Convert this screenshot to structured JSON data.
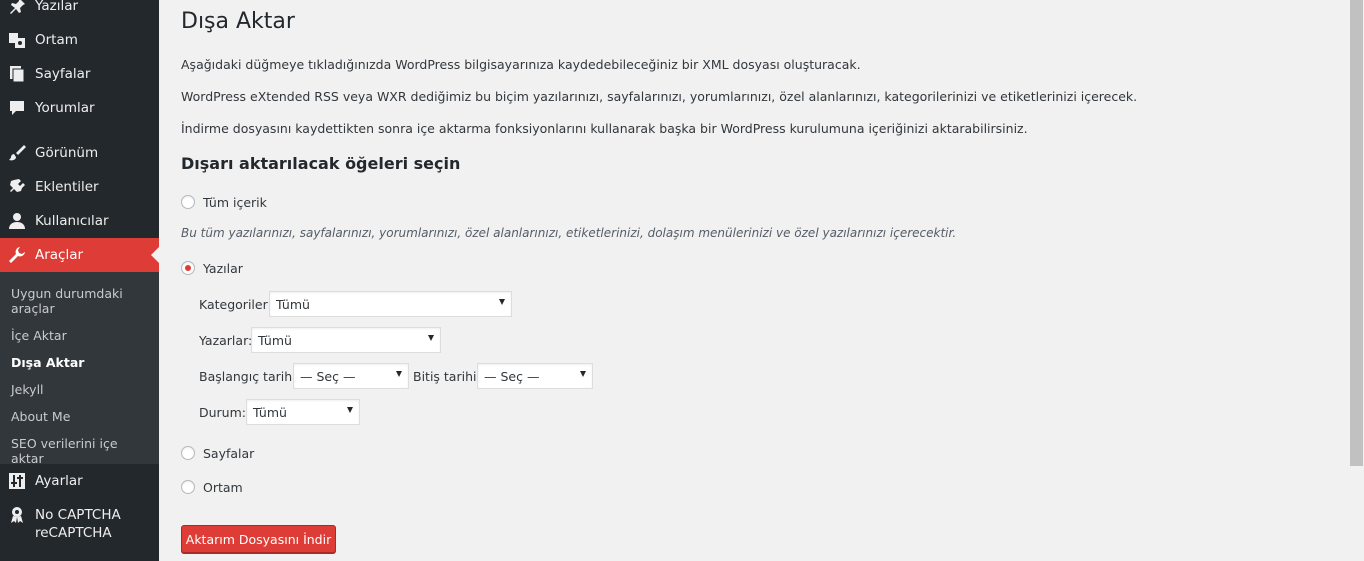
{
  "sidebar": {
    "items": [
      {
        "label": "Yazılar",
        "icon": "pushpin-icon"
      },
      {
        "label": "Ortam",
        "icon": "media-icon"
      },
      {
        "label": "Sayfalar",
        "icon": "pages-icon"
      },
      {
        "label": "Yorumlar",
        "icon": "comment-icon"
      },
      {
        "label": "Görünüm",
        "icon": "paintbrush-icon"
      },
      {
        "label": "Eklentiler",
        "icon": "plugin-icon"
      },
      {
        "label": "Kullanıcılar",
        "icon": "user-icon"
      },
      {
        "label": "Araçlar",
        "icon": "wrench-icon"
      },
      {
        "label": "Ayarlar",
        "icon": "settings-sliders-icon"
      },
      {
        "label": "No CAPTCHA reCAPTCHA",
        "icon": "badge-icon"
      }
    ],
    "submenu": [
      "Uygun durumdaki araçlar",
      "İçe Aktar",
      "Dışa Aktar",
      "Jekyll",
      "About Me",
      "SEO verilerini içe aktar"
    ]
  },
  "main": {
    "title": "Dışa Aktar",
    "paragraphs": [
      "Aşağıdaki düğmeye tıkladığınızda WordPress bilgisayarınıza kaydedebileceğiniz bir XML dosyası oluşturacak.",
      "WordPress eXtended RSS veya WXR dediğimiz bu biçim yazılarınızı, sayfalarınızı, yorumlarınızı, özel alanlarınızı, kategorilerinizi ve etiketlerinizi içerecek.",
      "İndirme dosyasını kaydettikten sonra içe aktarma fonksiyonlarını kullanarak başka bir WordPress kurulumuna içeriğinizi aktarabilirsiniz."
    ],
    "section_title": "Dışarı aktarılacak öğeleri seçin",
    "options": {
      "all": "Tüm içerik",
      "all_hint": "Bu tüm yazılarınızı, sayfalarınızı, yorumlarınızı, özel alanlarınızı, etiketlerinizi, dolaşım menülerinizi ve özel yazılarınızı içerecektir.",
      "posts": "Yazılar",
      "pages": "Sayfalar",
      "media": "Ortam"
    },
    "filters": {
      "categories_label": "Kategoriler:",
      "categories_value": "Tümü",
      "authors_label": "Yazarlar:",
      "authors_value": "Tümü",
      "start_date_label": "Başlangıç tarihi:",
      "start_date_value": "— Seç —",
      "end_date_label": "Bitiş tarihi:",
      "end_date_value": "— Seç —",
      "status_label": "Durum:",
      "status_value": "Tümü"
    },
    "submit_label": "Aktarım Dosyasını İndir"
  },
  "colors": {
    "accent": "#dd3d36",
    "sidebar": "#23282d",
    "submenu": "#32373c"
  }
}
